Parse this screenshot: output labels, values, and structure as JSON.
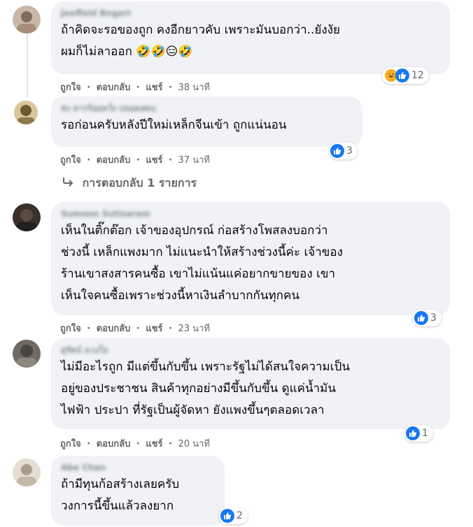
{
  "colors": {
    "bubble": "#f0f2f5",
    "meta_text": "#65676b",
    "like_blue": "#1877f2",
    "haha_yellow": "#f7b125"
  },
  "comments": [
    {
      "name": "Jeeffeid Bngeri",
      "text": "ถ้าคิดจะรอของถูก คงอีกยาวคับ เพราะมันบอกว่า..ยังงัย\nผมก็ไม่ลาออก 🤣🤣😑🤣",
      "like": "ถูกใจ",
      "reply": "ตอบกลับ",
      "share": "แชร์",
      "time": "38 นาที",
      "reactions": [
        "haha-icon",
        "like-icon"
      ],
      "reaction_count": "12"
    },
    {
      "name": "ส่ง สารร้อยหวั่ง ปลอดสดบ",
      "text": "รอก่อนครับหลังปีใหม่เหล็กจีนเข้า ถูกแน่นอน",
      "like": "ถูกใจ",
      "reply": "ตอบกลับ",
      "share": "แชร์",
      "time": "37 นาที",
      "reactions": [
        "like-icon"
      ],
      "reaction_count": "3"
    },
    {
      "name": "Sumoon Sutisaram",
      "text": "เห็นในติ๊กต๊อก เจ้าของอุปกรณ์ ก่อสร้างโพสลงบอกว่า\nช่วงนี้ เหล็กแพงมาก ไม่แนะนำให้สร้างช่วงนี้ค่ะ เจ้าของ\nร้านเขาสงสารคนซื้อ เขาไม่แน้นแค่อยากขายของ เขา\nเห็นใจคนซื้อเพราะช่วงนี้หาเงินลำบากกันทุกคน",
      "like": "ถูกใจ",
      "reply": "ตอบกลับ",
      "share": "แชร์",
      "time": "23 นาที",
      "reactions": [
        "like-icon"
      ],
      "reaction_count": "3"
    },
    {
      "name": "สุรัตน์ ดวงใจ",
      "text": "ไม่มีอะไรถูก มีแต่ขึ้นกับขึ้น เพราะรัฐไม่ได้สนใจความเป็น\nอยู่ของประชาชน สินค้าทุกอย่างมีขึ้นกับขึ้น ดูแค่น้ำมัน\nไฟฟ้า ประปา ที่รัฐเป็นผู้จัดหา ยังแพงขึ้นๆตลอดเวลา",
      "like": "ถูกใจ",
      "reply": "ตอบกลับ",
      "share": "แชร์",
      "time": "20 นาที",
      "reactions": [
        "like-icon"
      ],
      "reaction_count": "1"
    },
    {
      "name": "Abe Chan",
      "text": "ถ้ามีทุนก้อสร้างเลยครับ\nวงการนี้ขึ้นแล้วลงยาก",
      "reactions": [
        "like-icon"
      ],
      "reaction_count": "2"
    }
  ],
  "replies_link": "การตอบกลับ 1 รายการ",
  "separator": "·"
}
